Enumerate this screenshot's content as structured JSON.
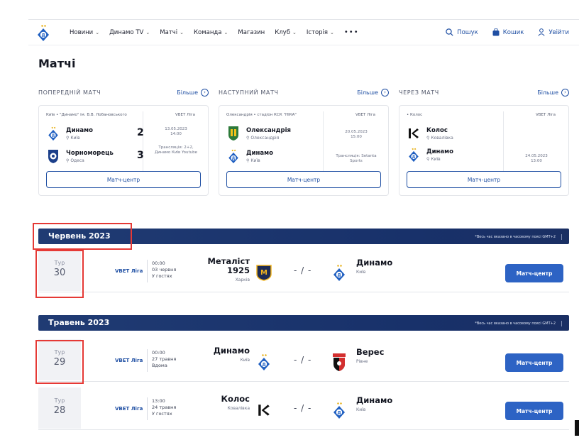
{
  "nav": {
    "items": [
      {
        "label": "Новини",
        "dropdown": true
      },
      {
        "label": "Динамо TV",
        "dropdown": true
      },
      {
        "label": "Матчі",
        "dropdown": true
      },
      {
        "label": "Команда",
        "dropdown": true
      },
      {
        "label": "Магазин",
        "dropdown": false
      },
      {
        "label": "Клуб",
        "dropdown": true
      },
      {
        "label": "Історія",
        "dropdown": true
      }
    ],
    "more": "•••",
    "search": "Пошук",
    "cart": "Кошик",
    "login": "Увійти"
  },
  "page_title": "Матчі",
  "more_label": "Більше",
  "match_center_label": "Матч-центр",
  "columns": [
    {
      "label": "ПОПЕРЕДНІЙ МАТЧ",
      "location": "Київ • \"Динамо\" ім. В.В. Лобановського",
      "league": "VBET Ліга",
      "home": {
        "name": "Динамо",
        "city": "Київ",
        "score": "2"
      },
      "away": {
        "name": "Чорноморець",
        "city": "Одеса",
        "score": "3"
      },
      "date": "13.05.2023",
      "time": "14:00",
      "broadcast": "Трансляція: 2+2, Динамо Київ Youtube"
    },
    {
      "label": "НАСТУПНИЙ МАТЧ",
      "location": "Олександрія • стадіон КСК \"НІКА\"",
      "league": "VBET Ліга",
      "home": {
        "name": "Олександрія",
        "city": "Олександрія"
      },
      "away": {
        "name": "Динамо",
        "city": "Київ"
      },
      "date": "20.05.2023",
      "time": "15:00",
      "broadcast": "Трансляція: Setanta Sports"
    },
    {
      "label": "ЧЕРЕЗ МАТЧ",
      "location": "• Колос",
      "league": "VBET Ліга",
      "home": {
        "name": "Колос",
        "city": "Ковалівка"
      },
      "away": {
        "name": "Динамо",
        "city": "Київ"
      },
      "date": "24.05.2023",
      "time": "13:00"
    }
  ],
  "months": [
    {
      "title": "Червень 2023",
      "note": "*Весь час вказано в часовому поясі GMT+2"
    },
    {
      "title": "Травень 2023",
      "note": "*Весь час вказано в часовому поясі GMT+2"
    }
  ],
  "tour_label": "Тур",
  "score_placeholder": "- / -",
  "rows": [
    {
      "tour": "30",
      "league": "VBET Ліга",
      "time": "00:00",
      "date": "03 червня",
      "venue": "У гостях",
      "home": {
        "name": "Металіст 1925",
        "city": "Харків"
      },
      "away": {
        "name": "Динамо",
        "city": "Київ"
      }
    },
    {
      "tour": "29",
      "league": "VBET Ліга",
      "time": "00:00",
      "date": "27 травня",
      "venue": "Вдома",
      "home": {
        "name": "Динамо",
        "city": "Київ"
      },
      "away": {
        "name": "Верес",
        "city": "Рівне"
      }
    },
    {
      "tour": "28",
      "league": "VBET Ліга",
      "time": "13:00",
      "date": "24 травня",
      "venue": "У гостях",
      "home": {
        "name": "Колос",
        "city": "Ковалівка"
      },
      "away": {
        "name": "Динамо",
        "city": "Київ"
      }
    }
  ],
  "colors": {
    "primary": "#1f4fa3",
    "button": "#2d63c4",
    "month_bar": "#1b3269",
    "highlight": "#e53935"
  }
}
